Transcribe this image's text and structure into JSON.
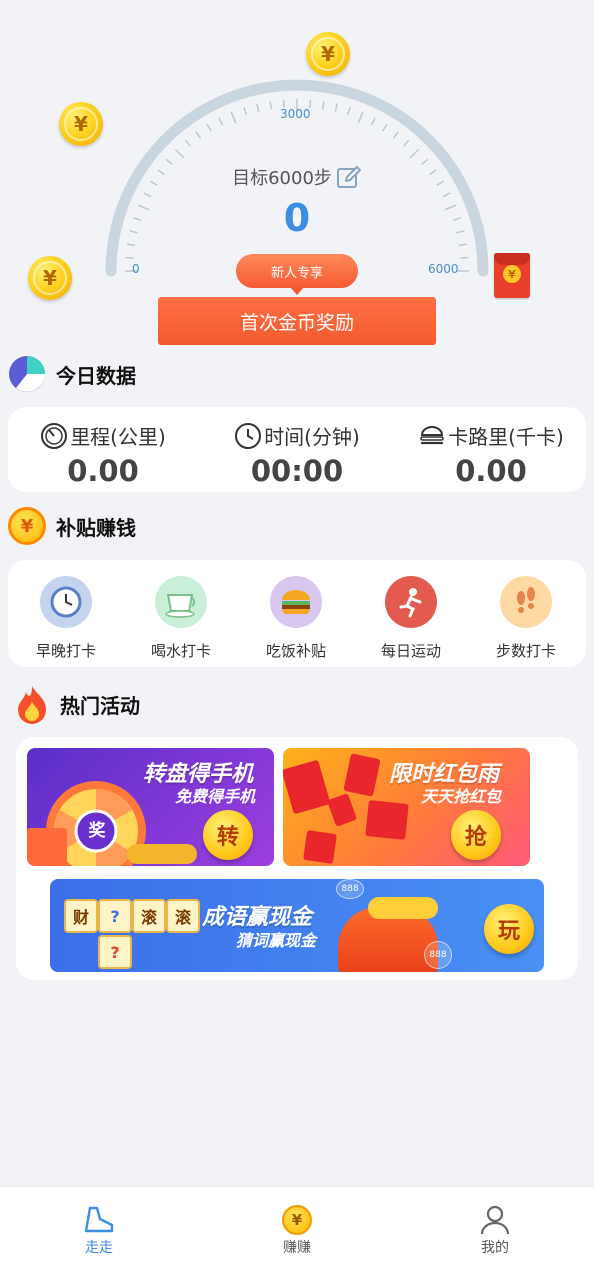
{
  "gauge": {
    "label_min": "0",
    "label_mid": "3000",
    "label_max": "6000",
    "goal_text": "目标6000步",
    "steps": "0",
    "badge": "新人专享",
    "reward_button": "首次金币奖励",
    "coin_symbol": "¥"
  },
  "today": {
    "title": "今日数据",
    "stats": [
      {
        "label": "里程(公里)",
        "value": "0.00",
        "icon": "speedometer-icon"
      },
      {
        "label": "时间(分钟)",
        "value": "00:00",
        "icon": "clock-icon"
      },
      {
        "label": "卡路里(千卡)",
        "value": "0.00",
        "icon": "burger-icon"
      }
    ]
  },
  "subsidy": {
    "title": "补贴赚钱",
    "items": [
      {
        "label": "早晚打卡",
        "icon": "alarm-clock-icon"
      },
      {
        "label": "喝水打卡",
        "icon": "teacup-icon"
      },
      {
        "label": "吃饭补贴",
        "icon": "burger-icon"
      },
      {
        "label": "每日运动",
        "icon": "runner-icon"
      },
      {
        "label": "步数打卡",
        "icon": "footprints-icon"
      }
    ]
  },
  "hot": {
    "title": "热门活动",
    "banners": {
      "wheel": {
        "title": "转盘得手机",
        "subtitle": "免费得手机",
        "button": "转",
        "center": "奖"
      },
      "redrain": {
        "title": "限时红包雨",
        "subtitle": "天天抢红包",
        "button": "抢"
      },
      "idiom": {
        "title": "成语赢现金",
        "subtitle": "猜词赢现金",
        "button": "玩",
        "tiles": [
          "财",
          "?",
          "滚",
          "滚",
          "?"
        ],
        "bubble": "888"
      }
    }
  },
  "tabbar": {
    "items": [
      {
        "label": "走走",
        "active": true
      },
      {
        "label": "赚赚",
        "active": false
      },
      {
        "label": "我的",
        "active": false
      }
    ]
  },
  "colors": {
    "accent": "#3c8ee3",
    "orange": "#f15a2e",
    "gauge_track": "#c9d6df"
  }
}
